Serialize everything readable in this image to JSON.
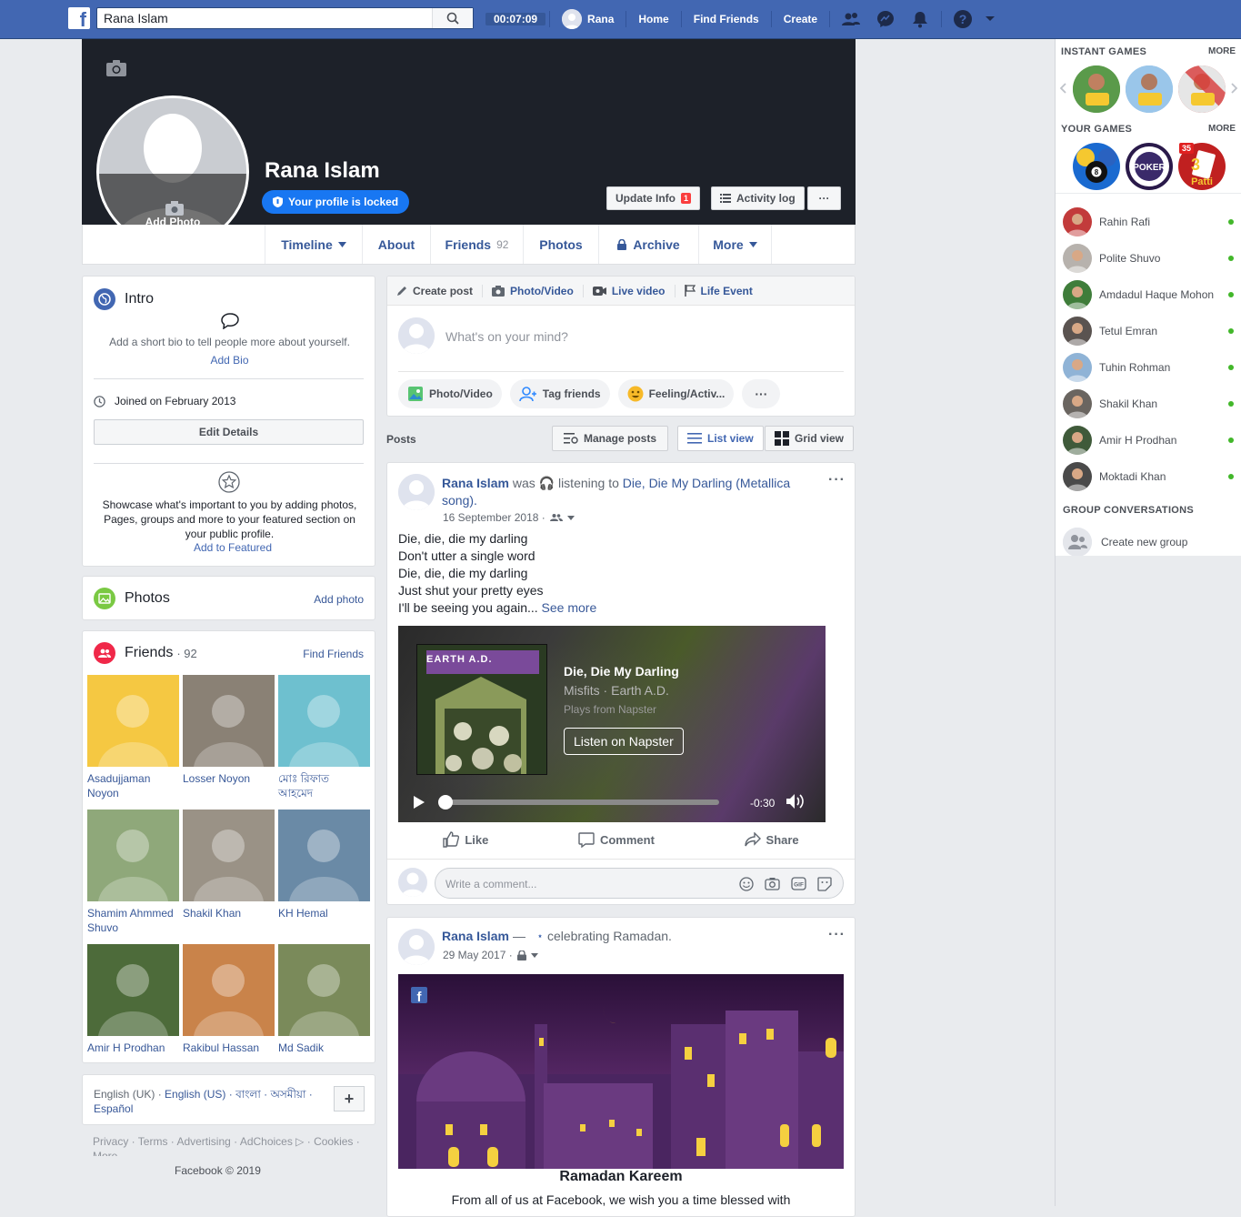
{
  "topbar": {
    "search_value": "Rana Islam",
    "timer": "00:07:09",
    "user_name": "Rana",
    "home": "Home",
    "find_friends": "Find Friends",
    "create": "Create"
  },
  "profile": {
    "name": "Rana Islam",
    "locked_label": "Your profile is locked",
    "add_photo": "Add Photo",
    "update_info": "Update Info",
    "update_badge": "1",
    "activity_log": "Activity log",
    "more_dots": "···"
  },
  "tabs": {
    "timeline": "Timeline",
    "about": "About",
    "friends": "Friends",
    "friends_count": "92",
    "photos": "Photos",
    "archive": "Archive",
    "more": "More"
  },
  "intro": {
    "title": "Intro",
    "bio_prompt": "Add a short bio to tell people more about yourself.",
    "add_bio": "Add Bio",
    "joined": "Joined on February 2013",
    "edit_details": "Edit Details",
    "featured_text": "Showcase what's important to you by adding photos, Pages, groups and more to your featured section on your public profile.",
    "add_featured": "Add to Featured"
  },
  "photos_card": {
    "title": "Photos",
    "add_photo": "Add photo"
  },
  "friends_card": {
    "title": "Friends",
    "count": "· 92",
    "find_friends": "Find Friends",
    "friends": [
      {
        "line1": "Asadujjaman",
        "line2": "Noyon",
        "color": "#f5c842"
      },
      {
        "line1": "Losser Noyon",
        "line2": "",
        "color": "#8a8175"
      },
      {
        "line1": "মোঃ রিফাত",
        "line2": "আহমেদ",
        "color": "#6ec0cf"
      },
      {
        "line1": "Shamim Ahmmed",
        "line2": "Shuvo",
        "color": "#8fa87a"
      },
      {
        "line1": "Shakil Khan",
        "line2": "",
        "color": "#9a9286"
      },
      {
        "line1": "KH Hemal",
        "line2": "",
        "color": "#6a8aa6"
      },
      {
        "line1": "Amir H Prodhan",
        "line2": "",
        "color": "#4d6b3a"
      },
      {
        "line1": "Rakibul Hassan",
        "line2": "",
        "color": "#c9834a"
      },
      {
        "line1": "Md Sadik",
        "line2": "",
        "color": "#7a8a5a"
      }
    ]
  },
  "footer": {
    "lang1": "English (UK) ·",
    "lang2": "English (US)",
    "lang3": "· বাংলা · অসমীয়া ·",
    "lang4": "Español",
    "plus": "+",
    "links": "Privacy · Terms · Advertising · AdChoices ▷ · Cookies ·",
    "more": "More",
    "copyright": "Facebook © 2019"
  },
  "composer": {
    "create_post": "Create post",
    "photo_video": "Photo/Video",
    "live_video": "Live video",
    "life_event": "Life Event",
    "placeholder": "What's on your mind?",
    "btn_photo": "Photo/Video",
    "btn_tag": "Tag friends",
    "btn_feeling": "Feeling/Activ...",
    "btn_more": "···"
  },
  "posts_bar": {
    "label": "Posts",
    "manage": "Manage posts",
    "list_view": "List view",
    "grid_view": "Grid view"
  },
  "post1": {
    "author": "Rana Islam",
    "was": "was",
    "listening": "listening to",
    "song_link": "Die, Die My Darling (Metallica song).",
    "date": "16 September 2018 ·",
    "lines": [
      "Die, die, die my darling",
      "Don't utter a single word",
      "Die, die, die my darling",
      "Just shut your pretty eyes",
      "I'll be seeing you again..."
    ],
    "see_more": "See more",
    "song_title": "Die, Die My Darling",
    "artist": "Misfits · Earth A.D.",
    "plays_from": "Plays from Napster",
    "listen_btn": "Listen on Napster",
    "time_left": "-0:30",
    "album_text": "EARTH A.D.",
    "like": "Like",
    "comment": "Comment",
    "share": "Share",
    "comment_placeholder": "Write a comment..."
  },
  "post2": {
    "author": "Rana Islam",
    "dash": "—",
    "activity": "celebrating Ramadan.",
    "date": "29 May 2017 ·",
    "image_title": "Ramadan Kareem",
    "image_caption": "From all of us at Facebook, we wish you a time blessed with"
  },
  "right": {
    "instant_games": "INSTANT GAMES",
    "your_games": "YOUR GAMES",
    "more": "MORE",
    "game_badge": "35",
    "contacts": [
      {
        "name": "Rahin Rafi",
        "color": "#c23b3b"
      },
      {
        "name": "Polite Shuvo",
        "color": "#b7b2ad"
      },
      {
        "name": "Amdadul Haque Mohon",
        "color": "#3f7d3a"
      },
      {
        "name": "Tetul Emran",
        "color": "#5a5350"
      },
      {
        "name": "Tuhin Rohman",
        "color": "#8fb3d6"
      },
      {
        "name": "Shakil Khan",
        "color": "#6a6560"
      },
      {
        "name": "Amir H Prodhan",
        "color": "#3f5a3a"
      },
      {
        "name": "Moktadi Khan",
        "color": "#4a4a4a"
      }
    ],
    "group_conversations": "GROUP CONVERSATIONS",
    "create_group": "Create new group"
  }
}
